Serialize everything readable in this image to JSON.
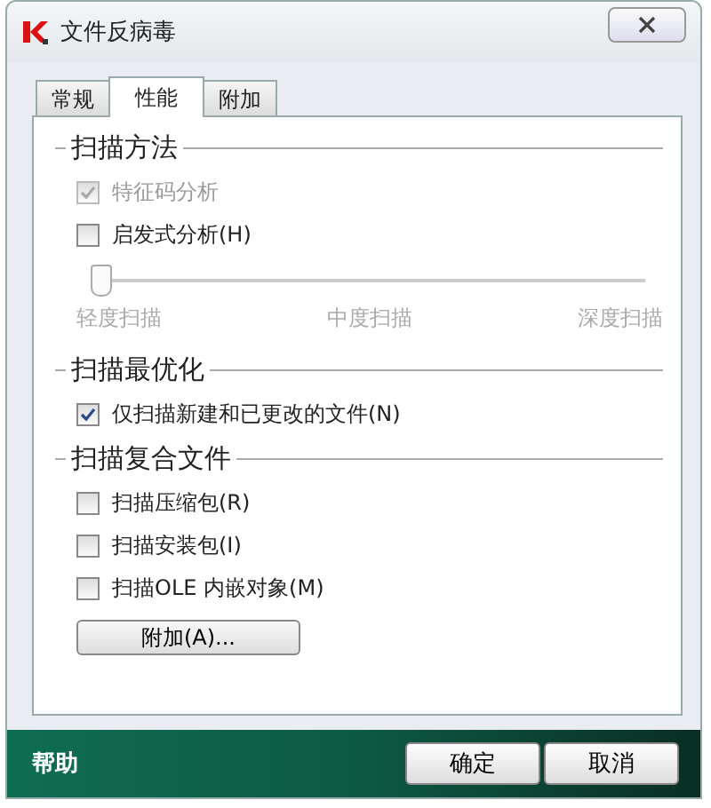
{
  "window": {
    "title": "文件反病毒"
  },
  "tabs": [
    {
      "label": "常规",
      "selected": false
    },
    {
      "label": "性能",
      "selected": true
    },
    {
      "label": "附加",
      "selected": false
    }
  ],
  "sections": [
    {
      "title": "扫描方法",
      "items": [
        {
          "kind": "checkbox",
          "label": "特征码分析",
          "checked": true,
          "disabled": true
        },
        {
          "kind": "checkbox",
          "label": "启发式分析(H)",
          "checked": false,
          "disabled": false
        },
        {
          "kind": "slider",
          "level": 0,
          "disabled": true,
          "ticks": [
            "轻度扫描",
            "中度扫描",
            "深度扫描"
          ]
        }
      ]
    },
    {
      "title": "扫描最优化",
      "items": [
        {
          "kind": "checkbox",
          "label": "仅扫描新建和已更改的文件(N)",
          "checked": true,
          "disabled": false
        }
      ]
    },
    {
      "title": "扫描复合文件",
      "items": [
        {
          "kind": "checkbox",
          "label": "扫描压缩包(R)",
          "checked": false,
          "disabled": false
        },
        {
          "kind": "checkbox",
          "label": "扫描安装包(I)",
          "checked": false,
          "disabled": false
        },
        {
          "kind": "checkbox",
          "label": "扫描OLE 内嵌对象(M)",
          "checked": false,
          "disabled": false
        }
      ]
    }
  ],
  "extra_button": "附加(A)...",
  "footer": {
    "help": "帮助",
    "buttons": [
      "确定",
      "取消"
    ]
  }
}
